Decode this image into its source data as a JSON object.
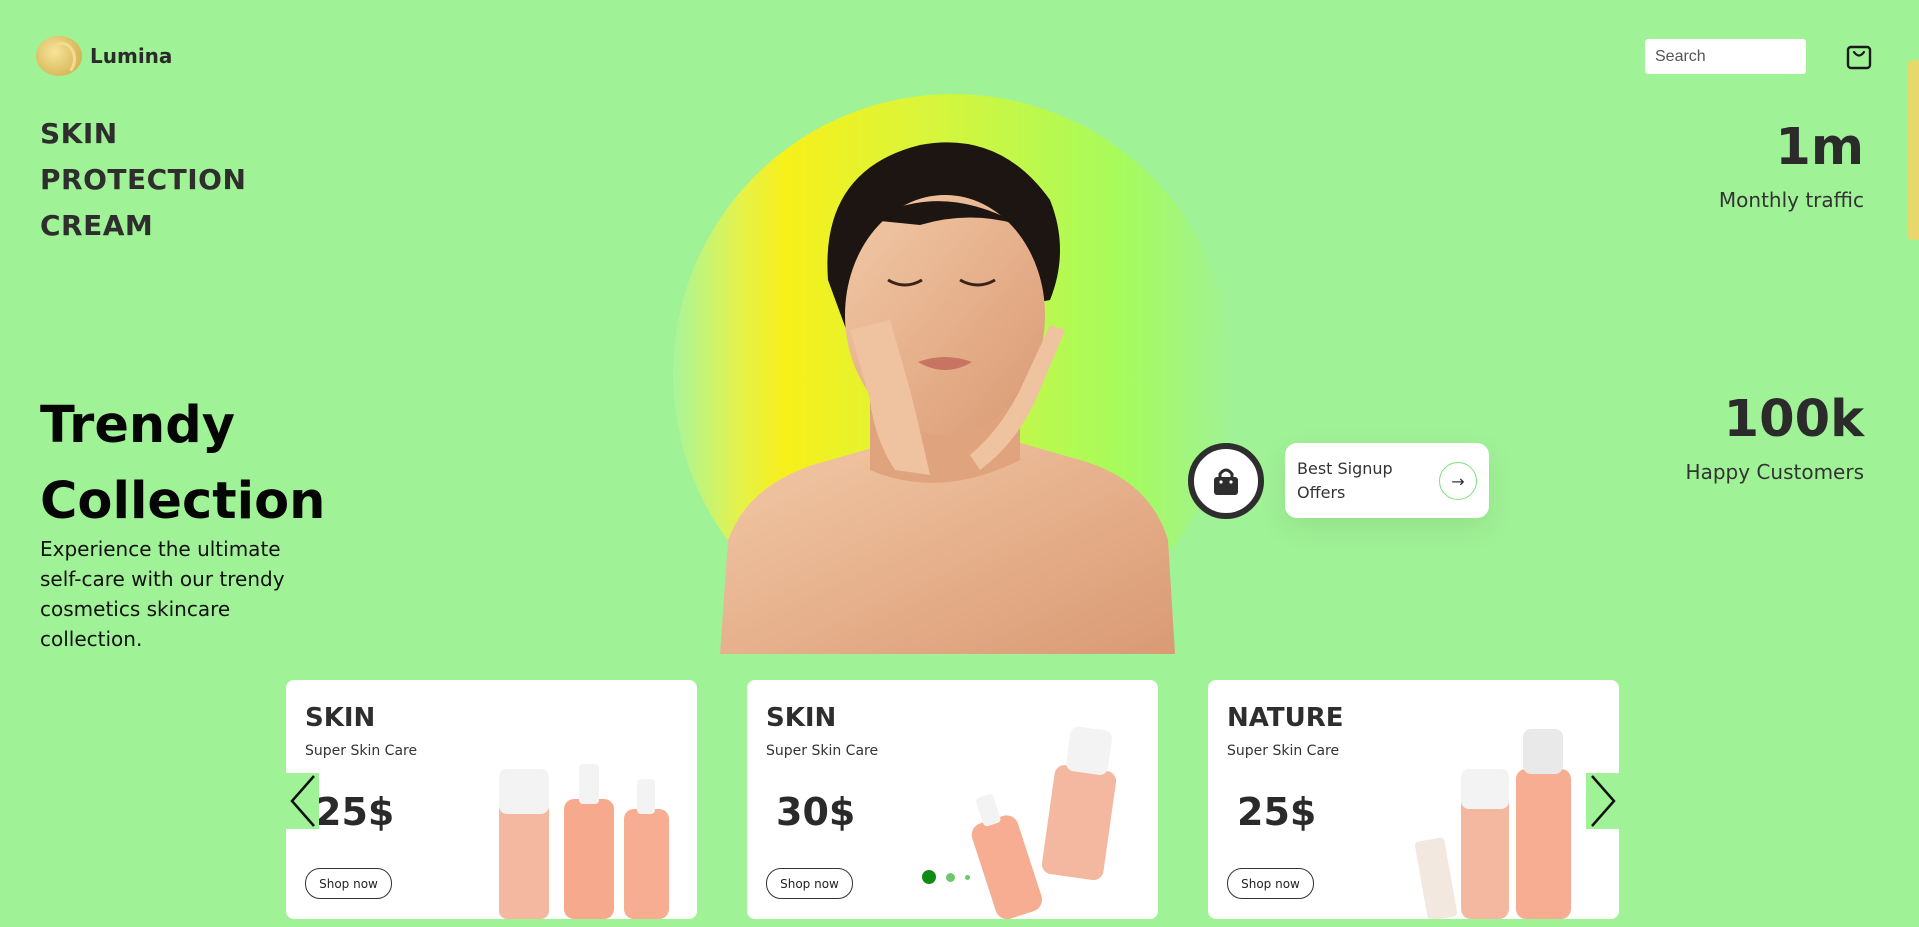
{
  "brand": {
    "name": "Lumina"
  },
  "search": {
    "placeholder": "Search"
  },
  "hero": {
    "headline": [
      "SKIN",
      "PROTECTION",
      "CREAM"
    ],
    "trendy_title": [
      "Trendy",
      "Collection"
    ],
    "trendy_desc": "Experience the ultimate self-care with our trendy cosmetics skincare collection."
  },
  "stats": [
    {
      "value": "1m",
      "label": "Monthly traffic"
    },
    {
      "value": "100k",
      "label": "Happy Customers"
    }
  ],
  "signup": {
    "text": "Best Signup Offers"
  },
  "cards": [
    {
      "title": "SKIN",
      "subtitle": "Super Skin Care",
      "price": "25$",
      "button": "Shop now"
    },
    {
      "title": "SKIN",
      "subtitle": "Super Skin Care",
      "price": "30$",
      "button": "Shop now"
    },
    {
      "title": "NATURE",
      "subtitle": "Super Skin Care",
      "price": "25$",
      "button": "Shop now"
    }
  ],
  "carousel": {
    "active_index": 0,
    "dot_count": 3
  },
  "colors": {
    "background": "#a0f296",
    "accent_dot": "#1a8a1a",
    "text_dark": "#2e2e2e"
  },
  "icons": {
    "cart": "shopping-bag-icon",
    "signup": "lock-bag-icon",
    "arrow": "arrow-right-icon",
    "prev": "chevron-left-icon",
    "next": "chevron-right-icon"
  }
}
